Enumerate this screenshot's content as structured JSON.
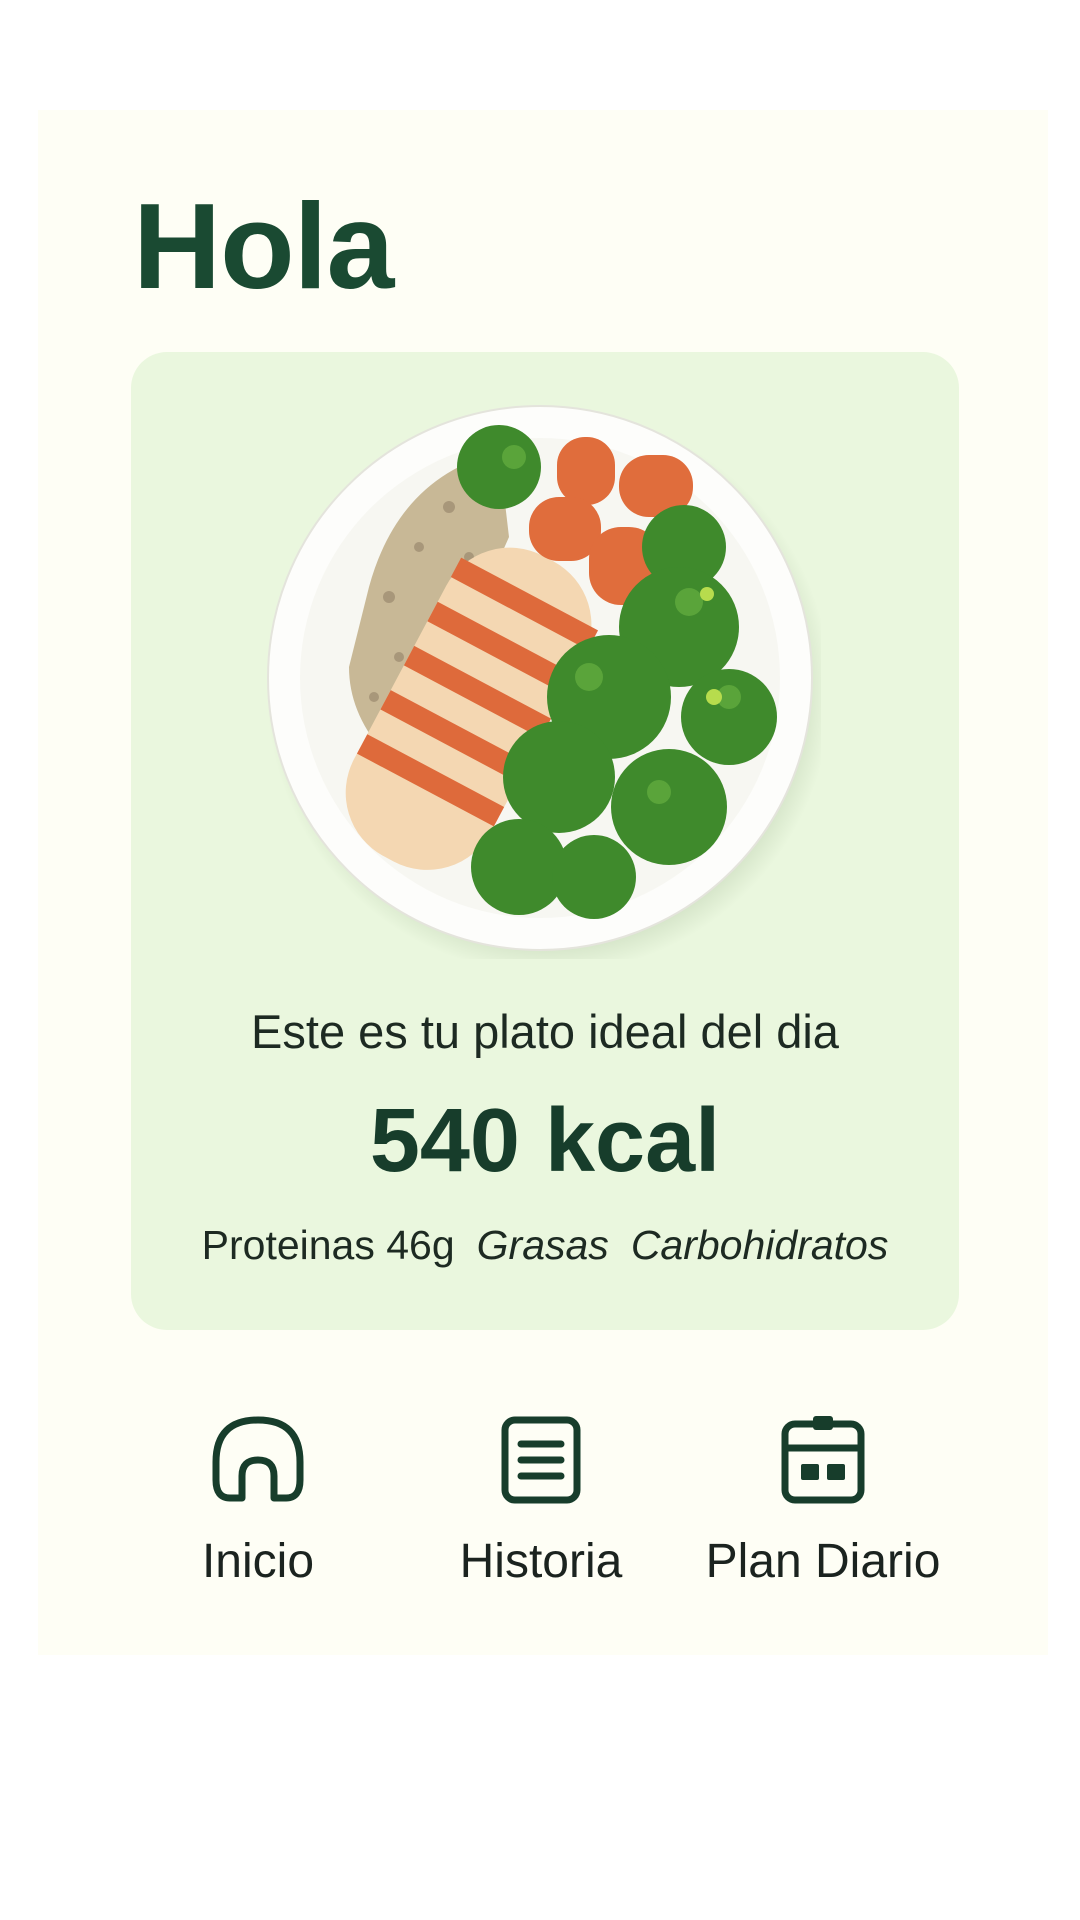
{
  "header": {
    "greeting": "Hola"
  },
  "meal_card": {
    "image": "plate-bowl-chicken-quinoa-carrots-broccoli",
    "caption": "Este es tu plato ideal del dia",
    "calories": "540 kcal",
    "macros": {
      "protein": "Proteinas 46g",
      "fats": "Grasas",
      "carbs": "Carbohidratos"
    }
  },
  "nav": {
    "items": [
      {
        "label": "Inicio",
        "icon": "home-icon"
      },
      {
        "label": "Historia",
        "icon": "document-icon"
      },
      {
        "label": "Plan Diario",
        "icon": "calendar-icon"
      }
    ]
  },
  "colors": {
    "brand_green": "#1a4a32",
    "card_bg": "#eaf7de",
    "screen_bg": "#fefef5"
  }
}
